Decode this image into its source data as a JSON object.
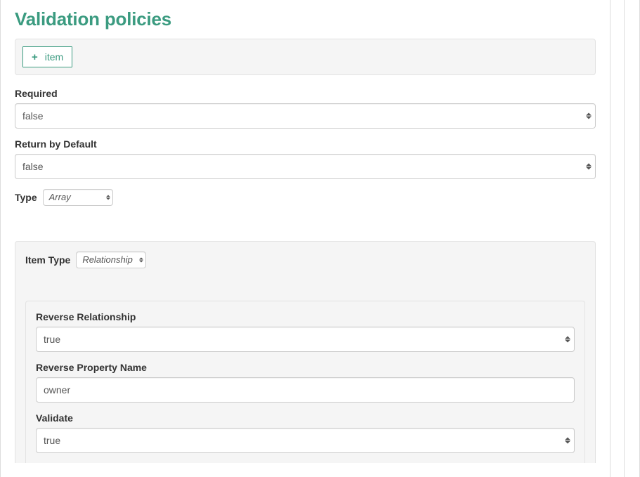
{
  "heading": "Validation policies",
  "addItem": {
    "label": "item",
    "icon": "plus-icon"
  },
  "fields": {
    "required": {
      "label": "Required",
      "value": "false"
    },
    "returnByDefault": {
      "label": "Return by Default",
      "value": "false"
    },
    "type": {
      "label": "Type",
      "value": "Array"
    }
  },
  "itemPanel": {
    "itemType": {
      "label": "Item Type",
      "value": "Relationship"
    },
    "reverseRelationship": {
      "label": "Reverse Relationship",
      "value": "true"
    },
    "reversePropertyName": {
      "label": "Reverse Property Name",
      "value": "owner"
    },
    "validate": {
      "label": "Validate",
      "value": "true"
    }
  },
  "colors": {
    "accent": "#3b9b80",
    "panelBg": "#f5f5f5",
    "border": "#e3e3e3"
  }
}
